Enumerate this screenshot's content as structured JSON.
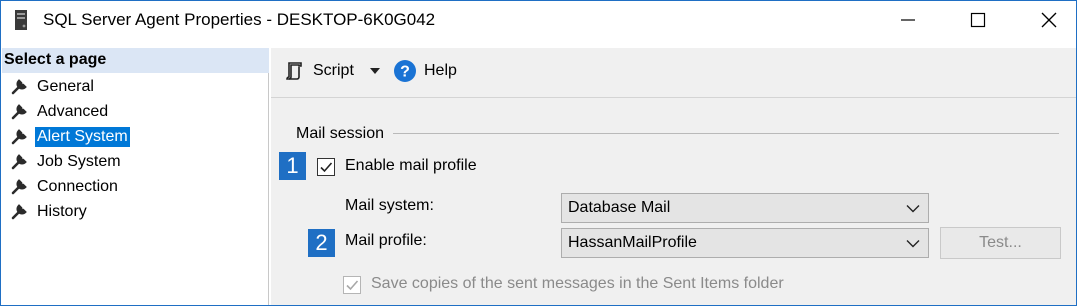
{
  "window": {
    "title": "SQL Server Agent Properties - DESKTOP-6K0G042",
    "accent_color": "#1f6fc4"
  },
  "left_panel": {
    "header": "Select a page",
    "items": [
      {
        "label": "General",
        "icon": "wrench-icon",
        "selected": false
      },
      {
        "label": "Advanced",
        "icon": "wrench-icon",
        "selected": false
      },
      {
        "label": "Alert System",
        "icon": "wrench-icon",
        "selected": true
      },
      {
        "label": "Job System",
        "icon": "wrench-icon",
        "selected": false
      },
      {
        "label": "Connection",
        "icon": "wrench-icon",
        "selected": false
      },
      {
        "label": "History",
        "icon": "wrench-icon",
        "selected": false
      }
    ]
  },
  "toolbar": {
    "script_label": "Script",
    "help_label": "Help"
  },
  "mail_session": {
    "section_title": "Mail session",
    "callouts": [
      "1",
      "2"
    ],
    "enable_mail_profile_label": "Enable mail profile",
    "enable_mail_profile_checked": true,
    "mail_system_label": "Mail system:",
    "mail_system_value": "Database Mail",
    "mail_profile_label": "Mail profile:",
    "mail_profile_value": "HassanMailProfile",
    "test_button_label": "Test...",
    "save_copies_label": "Save copies of the sent messages in the Sent Items folder",
    "save_copies_checked": true
  }
}
